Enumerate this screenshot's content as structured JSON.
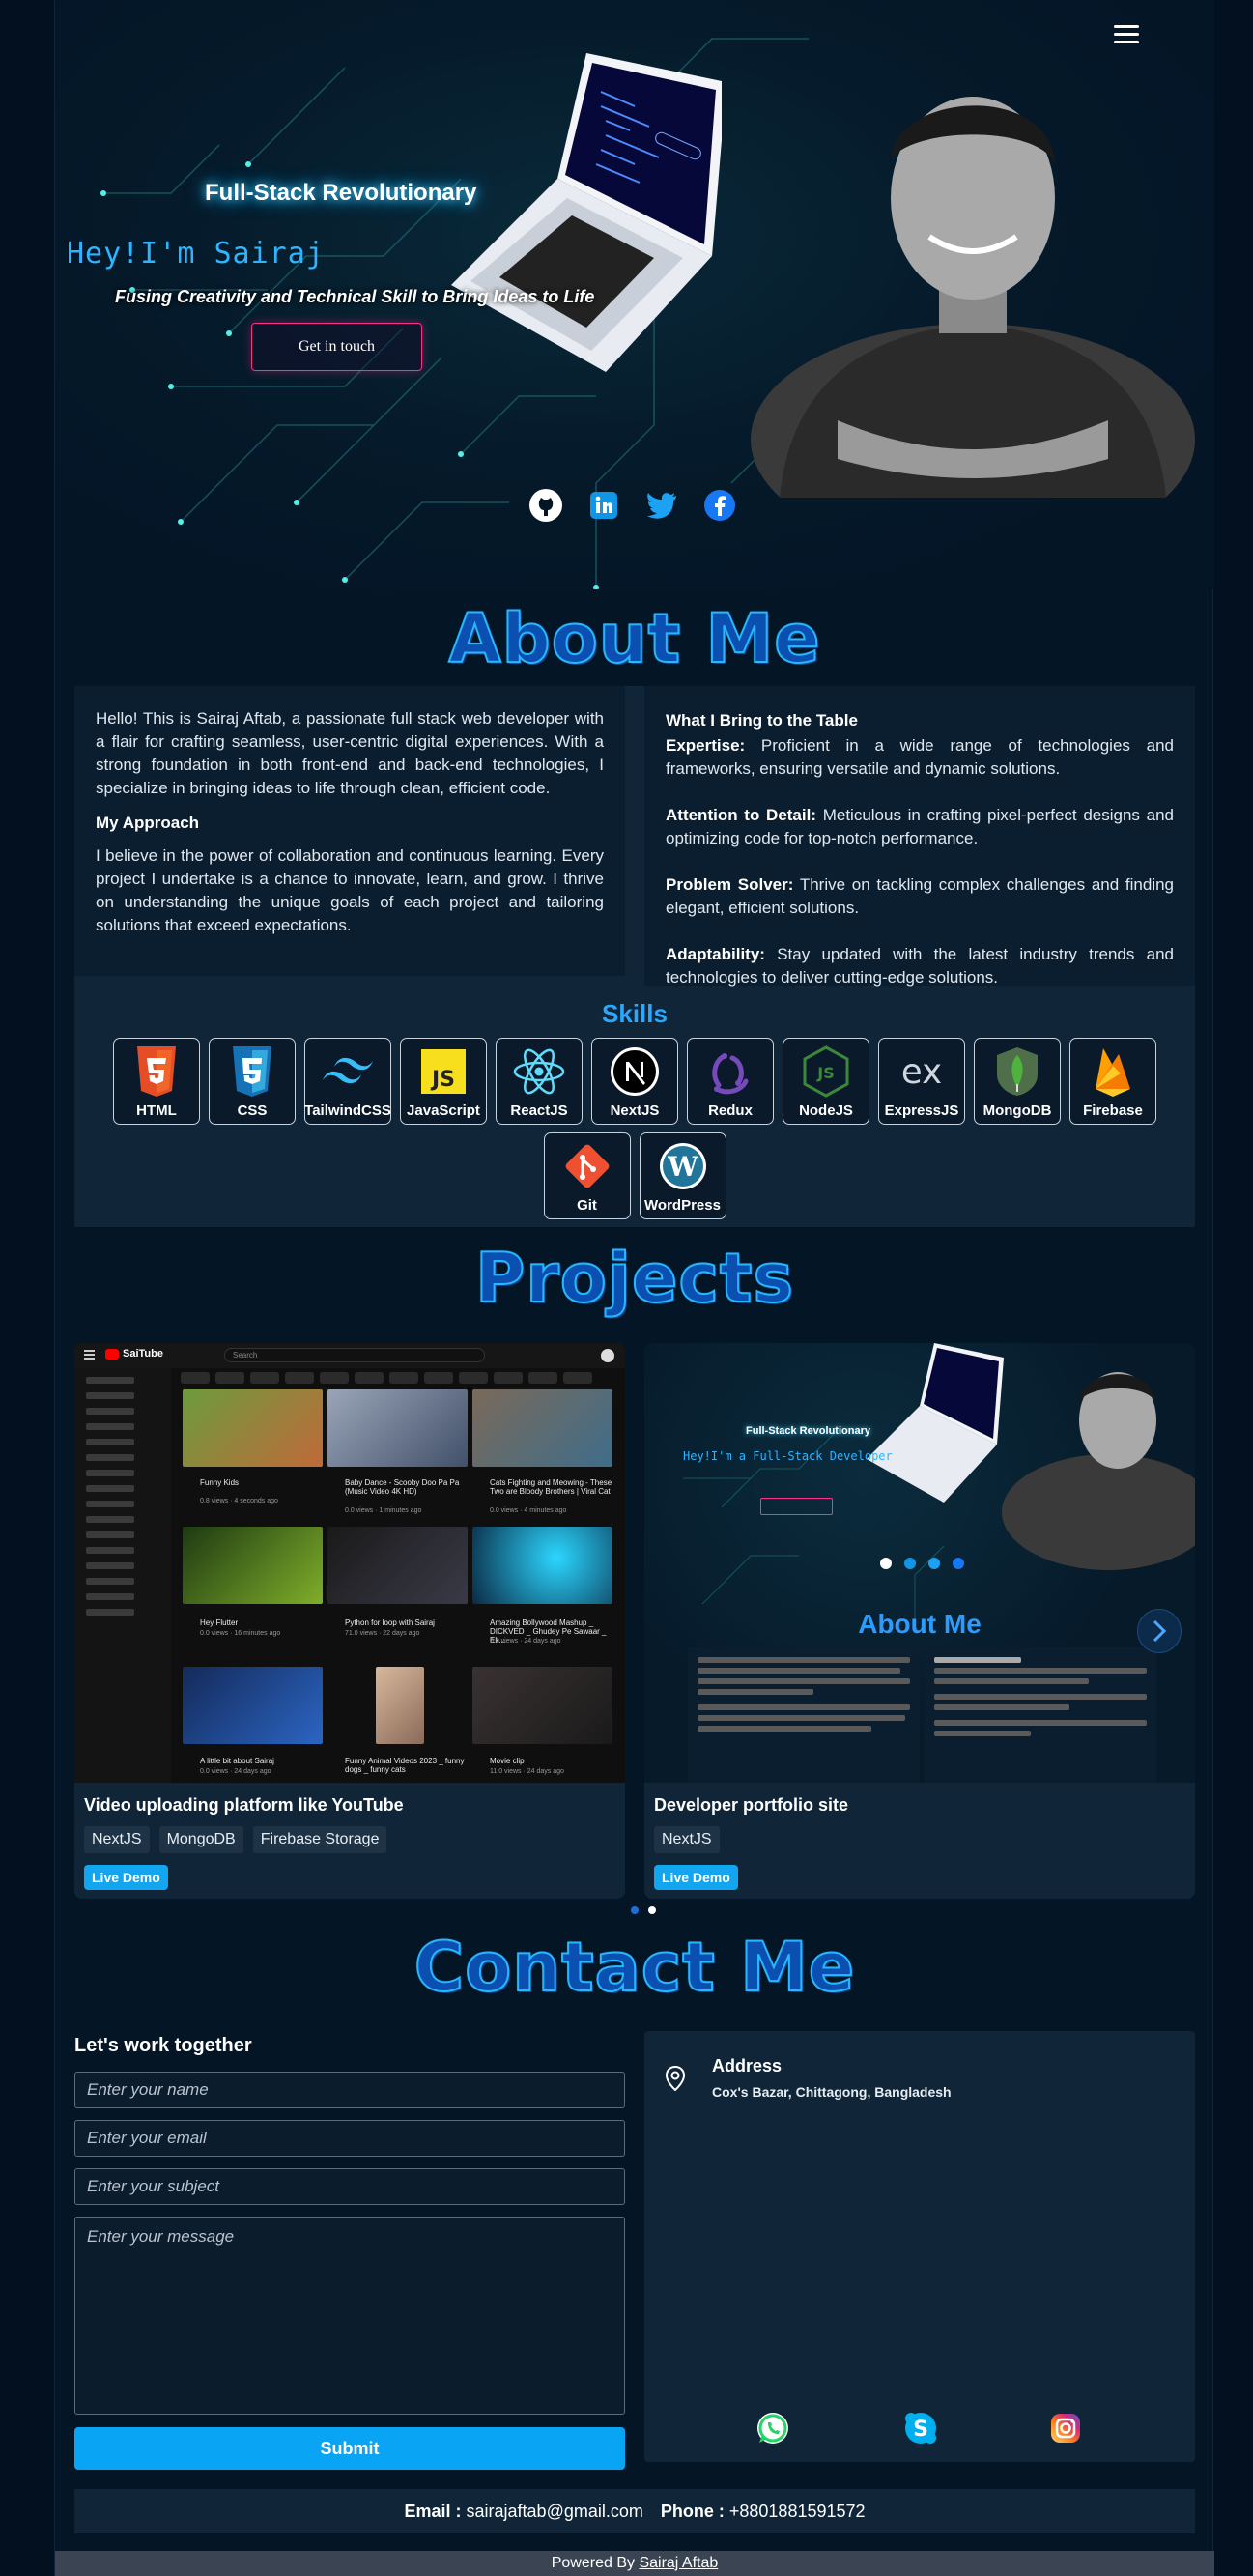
{
  "hero": {
    "role": "Full-Stack Revolutionary",
    "greeting": "Hey!I'm Sairaj",
    "tagline": "Fusing Creativity and Technical Skill to Bring Ideas to Life",
    "cta_label": "Get in touch",
    "socials": [
      "github-icon",
      "linkedin-icon",
      "twitter-icon",
      "facebook-icon"
    ],
    "accent": "#2fb4ff"
  },
  "about": {
    "title": "About Me",
    "intro": "Hello! This is Sairaj Aftab, a passionate full stack web developer with a flair for crafting seamless, user-centric digital experiences. With a strong foundation in both front-end and back-end technologies, I specialize in bringing ideas to life through clean, efficient code.",
    "approach_title": "My Approach",
    "approach_text": "I believe in the power of collaboration and continuous learning. Every project I undertake is a chance to innovate, learn, and grow. I thrive on understanding the unique goals of each project and tailoring solutions that exceed expectations.",
    "bring_title": "What I Bring to the Table",
    "points": [
      {
        "label": "Expertise:",
        "text": " Proficient in a wide range of technologies and frameworks, ensuring versatile and dynamic solutions."
      },
      {
        "label": "Attention to Detail:",
        "text": " Meticulous in crafting pixel-perfect designs and optimizing code for top-notch performance."
      },
      {
        "label": "Problem Solver:",
        "text": " Thrive on tackling complex challenges and finding elegant, efficient solutions."
      },
      {
        "label": "Adaptability:",
        "text": " Stay updated with the latest industry trends and technologies to deliver cutting-edge solutions."
      }
    ],
    "skills_title": "Skills",
    "skills": [
      "HTML",
      "CSS",
      "TailwindCSS",
      "JavaScript",
      "ReactJS",
      "NextJS",
      "Redux",
      "NodeJS",
      "ExpressJS",
      "MongoDB",
      "Firebase",
      "Git",
      "WordPress"
    ]
  },
  "projects": {
    "title": "Projects",
    "items": [
      {
        "name": "Video uploading platform like YouTube",
        "tags": [
          "NextJS",
          "MongoDB",
          "Firebase Storage"
        ],
        "live_label": "Live Demo"
      },
      {
        "name": "Developer portfolio site",
        "tags": [
          "NextJS"
        ],
        "live_label": "Live Demo"
      }
    ],
    "yt_mock": {
      "brand": "SaiTube",
      "search_placeholder": "Search",
      "videos": [
        {
          "title": "Funny Kids",
          "meta": "0.8 views · 4 seconds ago"
        },
        {
          "title": "Baby Dance - Scooby Doo Pa Pa (Music Video 4K HD)",
          "meta": "0.0 views · 1 minutes ago"
        },
        {
          "title": "Cats Fighting and Meowing - These Two are Bloody Brothers | Viral Cat",
          "meta": "0.0 views · 4 minutes ago"
        },
        {
          "title": "Hey Flutter",
          "meta": "0.0 views · 16 minutes ago"
        },
        {
          "title": "Python for loop with Sairaj",
          "meta": "71.0 views · 22 days ago"
        },
        {
          "title": "Amazing Bollywood Mashup _ DICKVED _ Ghudey Pe Sawaar _ Ek...",
          "meta": "0.0 views · 24 days ago"
        },
        {
          "title": "A little bit about Sairaj",
          "meta": "0.0 views · 24 days ago"
        },
        {
          "title": "Funny Animal Videos 2023 _ funny dogs _ funny cats",
          "meta": ""
        },
        {
          "title": "Movie clip",
          "meta": "11.0 views · 24 days ago"
        }
      ]
    },
    "pf_mock": {
      "role": "Full-Stack Revolutionary",
      "greeting": "Hey!I'm a Full-Stack Developer",
      "about_title": "About Me"
    }
  },
  "contact": {
    "title": "Contact Me",
    "subtitle": "Let's work together",
    "name_placeholder": "Enter your name",
    "email_placeholder": "Enter your email",
    "subject_placeholder": "Enter your subject",
    "message_placeholder": "Enter your message",
    "submit_label": "Submit",
    "address_title": "Address",
    "address_text": "Cox's Bazar, Chittagong, Bangladesh",
    "email_label": "Email :",
    "email": "sairajaftab@gmail.com",
    "phone_label": "Phone :",
    "phone": "+8801881591572"
  },
  "footer": {
    "powered_by": "Powered By",
    "author": "Sairaj Aftab"
  }
}
